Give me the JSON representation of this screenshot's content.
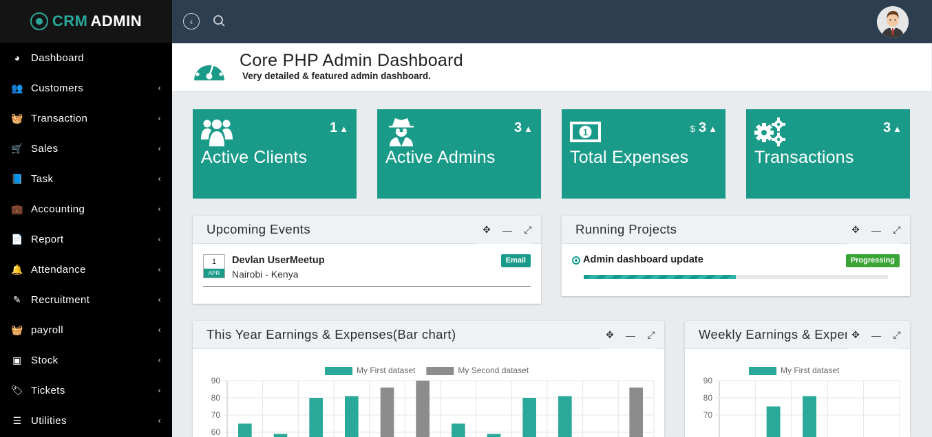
{
  "brand": {
    "part1": "CRM",
    "part2": "ADMIN"
  },
  "sidebar": {
    "items": [
      {
        "label": "Dashboard",
        "icon": "tachometer-icon",
        "glyph": "◕",
        "has_children": false
      },
      {
        "label": "Customers",
        "icon": "users-icon",
        "glyph": "👥",
        "has_children": true
      },
      {
        "label": "Transaction",
        "icon": "basket-icon",
        "glyph": "🧺",
        "has_children": true
      },
      {
        "label": "Sales",
        "icon": "cart-icon",
        "glyph": "🛒",
        "has_children": true
      },
      {
        "label": "Task",
        "icon": "book-icon",
        "glyph": "📘",
        "has_children": true
      },
      {
        "label": "Accounting",
        "icon": "briefcase-icon",
        "glyph": "💼",
        "has_children": true
      },
      {
        "label": "Report",
        "icon": "file-icon",
        "glyph": "📄",
        "has_children": true
      },
      {
        "label": "Attendance",
        "icon": "bell-icon",
        "glyph": "🔔",
        "has_children": true
      },
      {
        "label": "Recruitment",
        "icon": "edit-icon",
        "glyph": "✎",
        "has_children": true
      },
      {
        "label": "payroll",
        "icon": "basket-icon",
        "glyph": "🧺",
        "has_children": true
      },
      {
        "label": "Stock",
        "icon": "hdd-icon",
        "glyph": "▣",
        "has_children": true
      },
      {
        "label": "Tickets",
        "icon": "tag-icon",
        "glyph": "🏷",
        "has_children": true
      },
      {
        "label": "Utilities",
        "icon": "list-icon",
        "glyph": "☰",
        "has_children": true
      }
    ],
    "chevron": "‹"
  },
  "topbar": {
    "back_glyph": "‹"
  },
  "header": {
    "title": "Core PHP Admin Dashboard",
    "subtitle": "Very detailed & featured admin dashboard."
  },
  "cards": [
    {
      "title": "Active Clients",
      "count": "1",
      "currency": "",
      "icon": "users-icon"
    },
    {
      "title": "Active Admins",
      "count": "3",
      "currency": "",
      "icon": "user-secret-icon"
    },
    {
      "title": "Total Expenses",
      "count": "3",
      "currency": "$",
      "icon": "money-icon"
    },
    {
      "title": "Transactions",
      "count": "3",
      "currency": "",
      "icon": "cogs-icon"
    }
  ],
  "trend_glyph": "▲",
  "panels": {
    "events": {
      "title": "Upcoming Events",
      "items": [
        {
          "day": "1",
          "month": "APR",
          "name": "Devlan UserMeetup",
          "location": "Nairobi - Kenya",
          "badge": "Email"
        }
      ]
    },
    "projects": {
      "title": "Running Projects",
      "items": [
        {
          "name": "Admin dashboard update",
          "status": "Progressing",
          "progress": 0.5
        }
      ]
    },
    "bar_panel": {
      "title": "This Year Earnings & Expenses(Bar chart)"
    },
    "weekly_panel": {
      "title": "Weekly Earnings & Expenses"
    }
  },
  "colors": {
    "accent": "#1a9b8a",
    "series1": "#2aa89a",
    "series2": "#8c8c8c",
    "progress_badge": "#3aa536",
    "sidebar_bg": "#000000",
    "topbar_bg": "#2c3e50"
  },
  "chart_data": [
    {
      "type": "bar",
      "title": "",
      "xlabel": "",
      "ylabel": "",
      "ylim": [
        60,
        90
      ],
      "yticks": [
        60,
        70,
        80,
        90
      ],
      "legend": "top",
      "grid": true,
      "categories": [
        "",
        "",
        "",
        "",
        "",
        "",
        "",
        "",
        "",
        "",
        "",
        ""
      ],
      "series": [
        {
          "name": "My First dataset",
          "values": [
            65,
            59,
            80,
            81,
            null,
            null,
            65,
            59,
            80,
            81,
            null,
            null
          ]
        },
        {
          "name": "My Second dataset",
          "values": [
            null,
            null,
            null,
            null,
            86,
            90,
            null,
            null,
            null,
            null,
            null,
            86
          ]
        }
      ]
    },
    {
      "type": "bar",
      "title": "",
      "xlabel": "",
      "ylabel": "",
      "ylim": [
        60,
        90
      ],
      "yticks": [
        70,
        80,
        90
      ],
      "legend": "top",
      "grid": true,
      "categories": [
        "",
        "",
        "",
        "",
        ""
      ],
      "series": [
        {
          "name": "My First dataset",
          "values": [
            null,
            75,
            81,
            null,
            null
          ]
        }
      ]
    }
  ]
}
